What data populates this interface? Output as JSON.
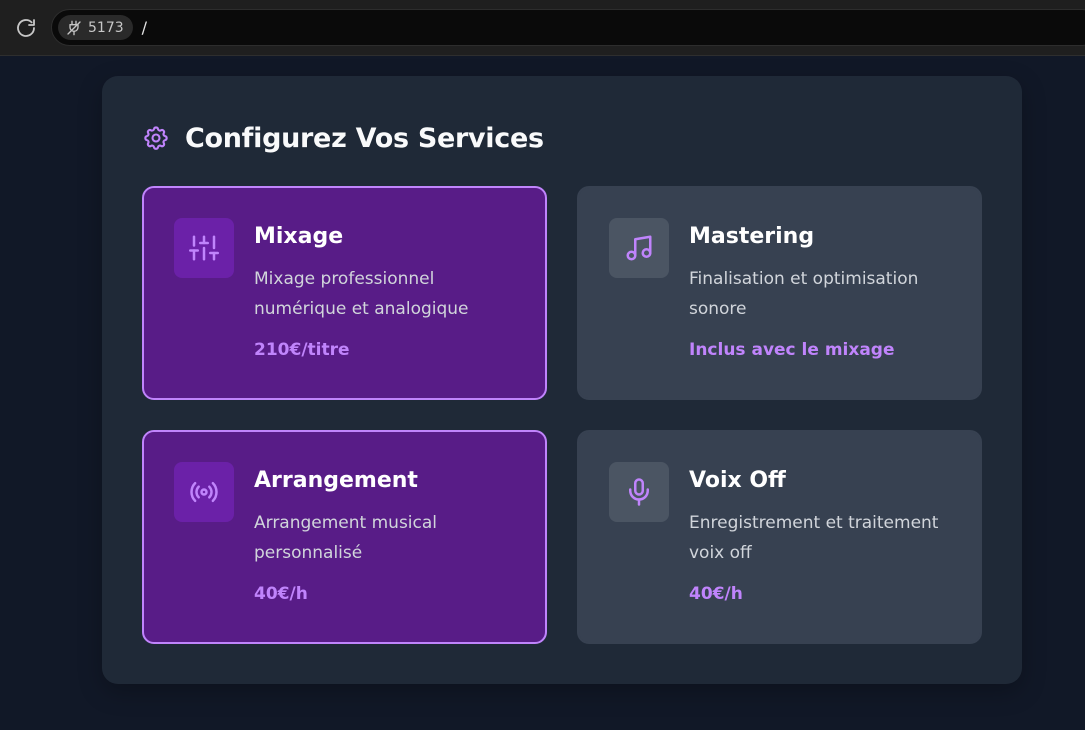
{
  "browser": {
    "port": "5173",
    "path": "/"
  },
  "panel": {
    "title": "Configurez Vos Services"
  },
  "services": [
    {
      "title": "Mixage",
      "description": "Mixage professionnel numérique et analogique",
      "price": "210€/titre",
      "selected": true,
      "icon": "sliders-icon"
    },
    {
      "title": "Mastering",
      "description": "Finalisation et optimisation sonore",
      "price": "Inclus avec le mixage",
      "selected": false,
      "icon": "music-note-icon"
    },
    {
      "title": "Arrangement",
      "description": "Arrangement musical personnalisé",
      "price": "40€/h",
      "selected": true,
      "icon": "broadcast-icon"
    },
    {
      "title": "Voix Off",
      "description": "Enregistrement et traitement voix off",
      "price": "40€/h",
      "selected": false,
      "icon": "microphone-icon"
    }
  ],
  "colors": {
    "page_bg": "#111827",
    "panel_bg": "#1f2937",
    "selected_card_bg": "#581c87",
    "selected_border": "#c084fc",
    "unselected_card_bg": "#374151",
    "accent": "#c084fc"
  }
}
